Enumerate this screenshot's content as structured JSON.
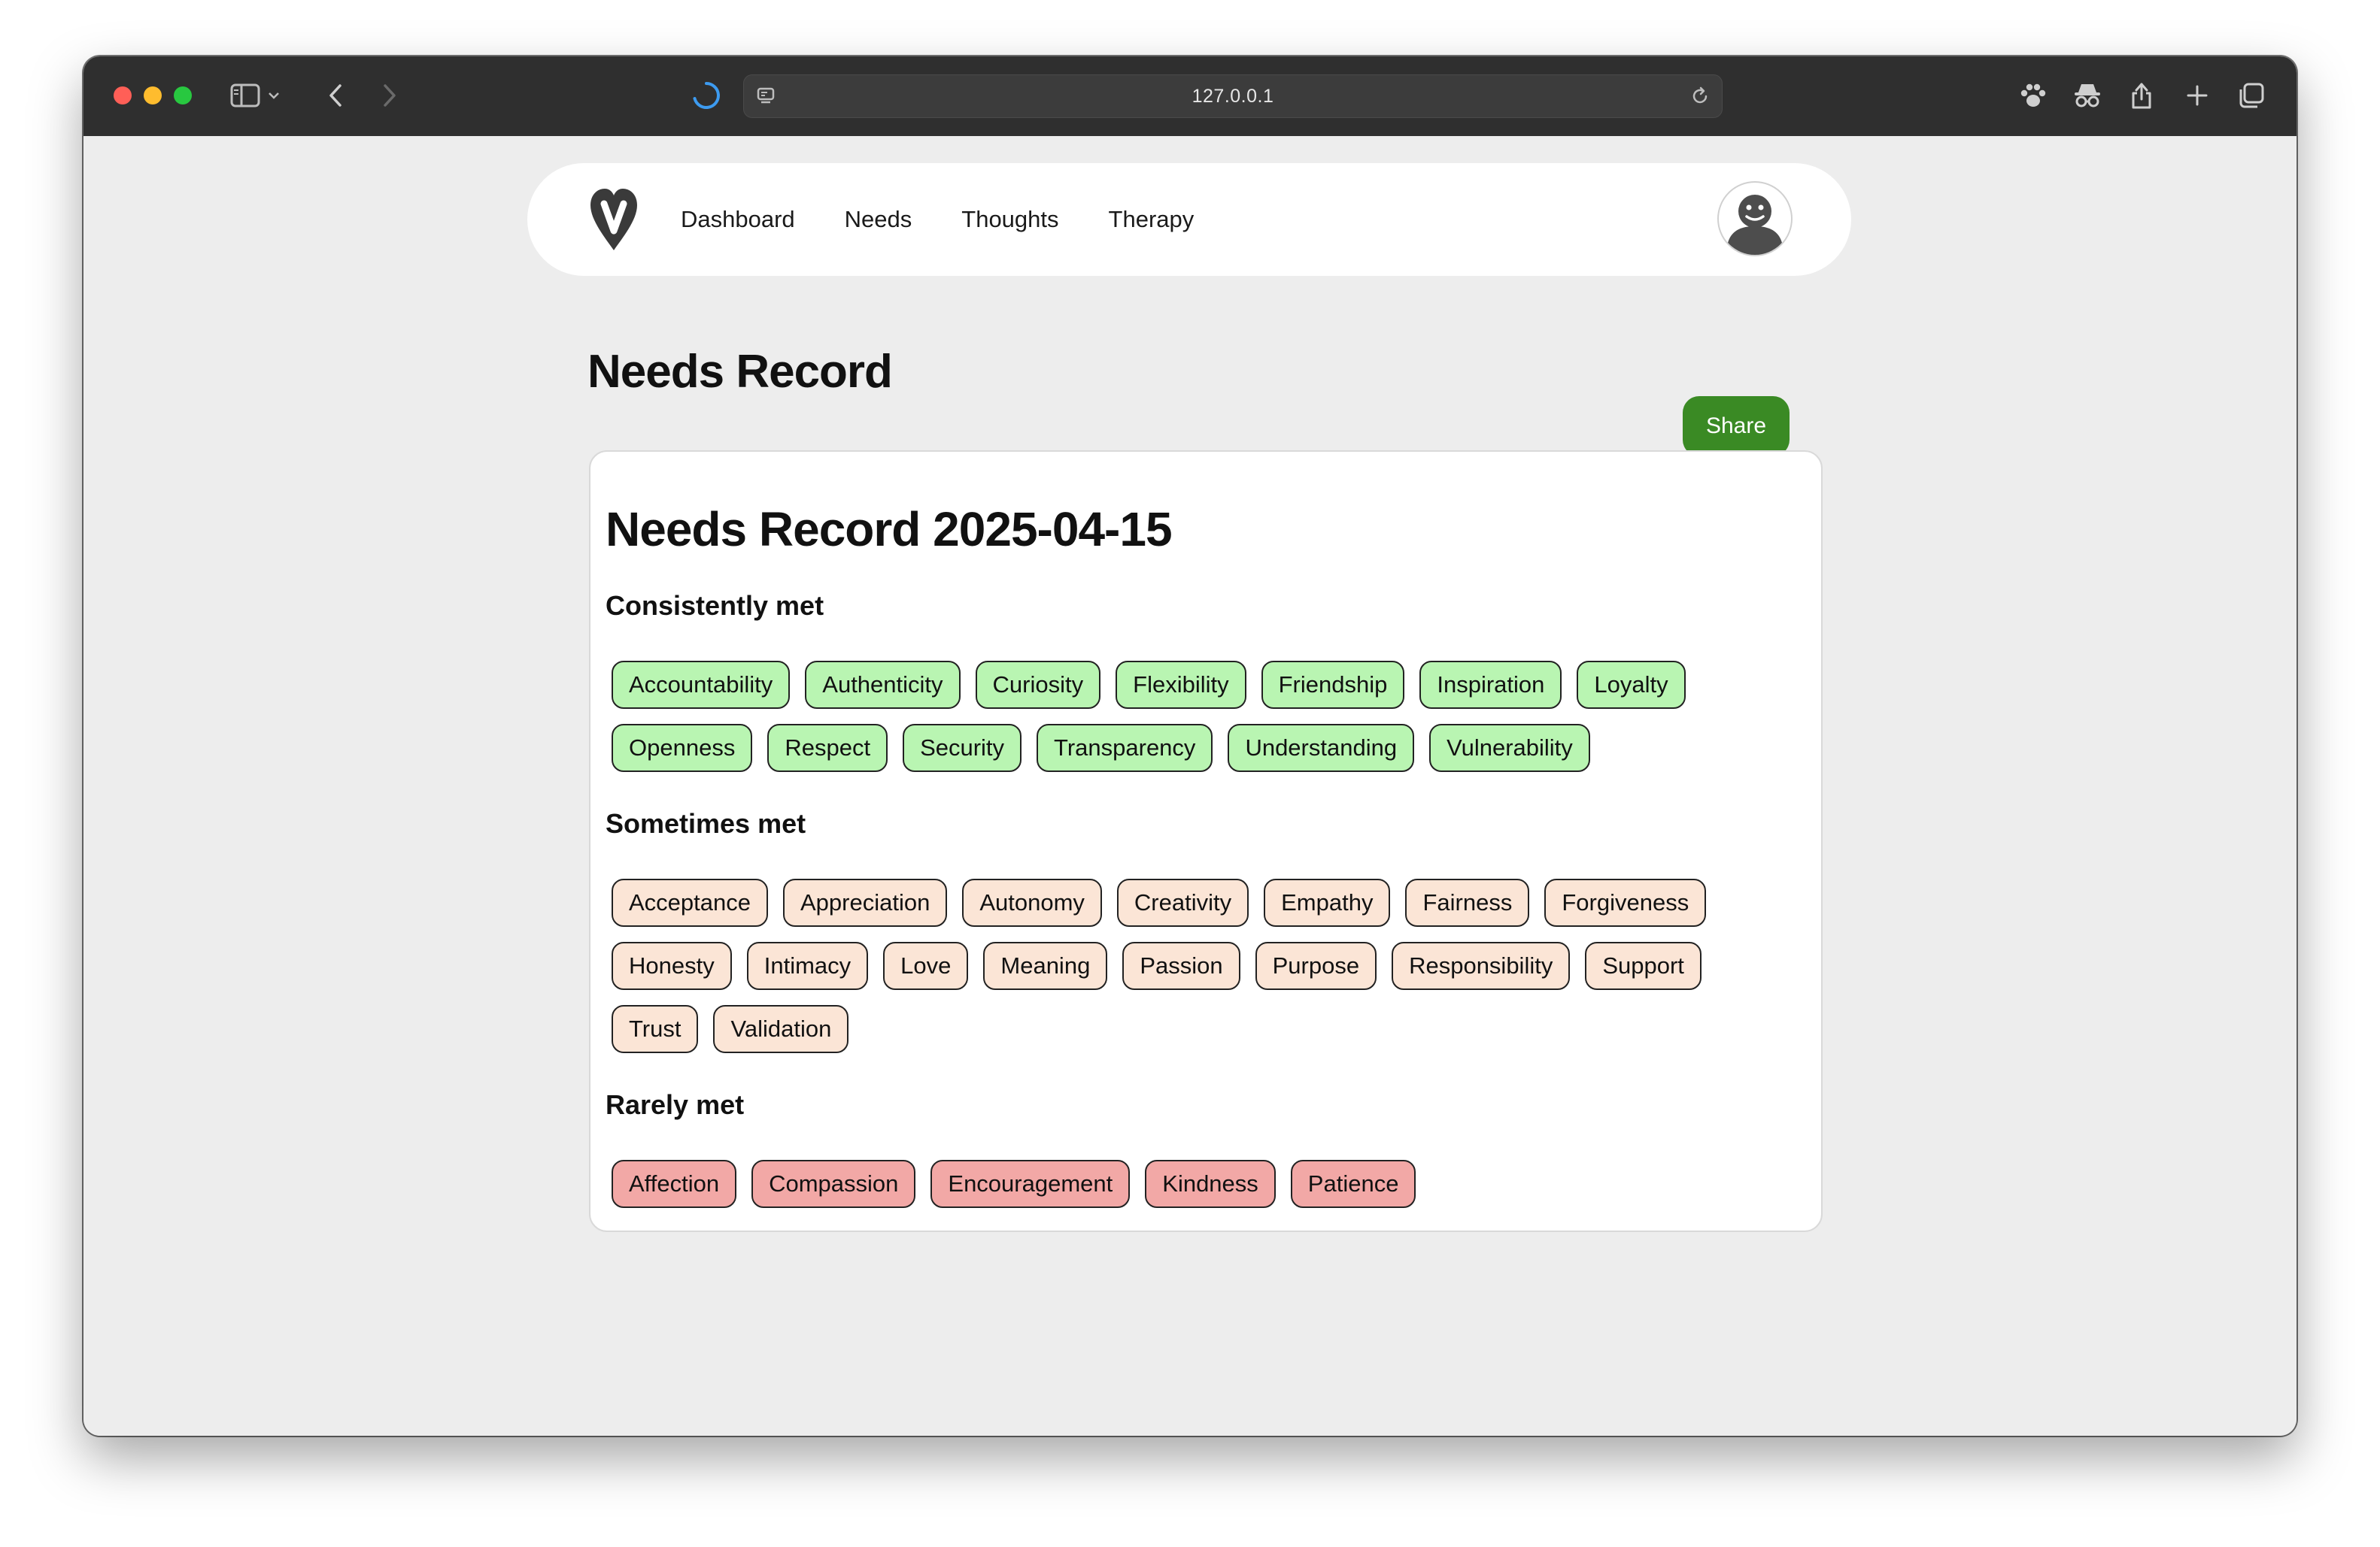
{
  "browser": {
    "url": "127.0.0.1",
    "icons": [
      "sidebar-icon",
      "chevron-down-icon",
      "back-icon",
      "forward-icon",
      "loading-spinner-icon",
      "site-settings-icon",
      "reload-icon",
      "paw-icon",
      "incognito-icon",
      "share-icon",
      "new-tab-icon",
      "tabs-overview-icon"
    ]
  },
  "nav": {
    "links": [
      "Dashboard",
      "Needs",
      "Thoughts",
      "Therapy"
    ]
  },
  "page": {
    "title": "Needs Record",
    "share_label": "Share"
  },
  "record": {
    "title": "Needs Record 2025-04-15",
    "sections": [
      {
        "heading": "Consistently met",
        "color": "#b9f5b2",
        "needs": [
          "Accountability",
          "Authenticity",
          "Curiosity",
          "Flexibility",
          "Friendship",
          "Inspiration",
          "Loyalty",
          "Openness",
          "Respect",
          "Security",
          "Transparency",
          "Understanding",
          "Vulnerability"
        ]
      },
      {
        "heading": "Sometimes met",
        "color": "#fbe5d6",
        "needs": [
          "Acceptance",
          "Appreciation",
          "Autonomy",
          "Creativity",
          "Empathy",
          "Fairness",
          "Forgiveness",
          "Honesty",
          "Intimacy",
          "Love",
          "Meaning",
          "Passion",
          "Purpose",
          "Responsibility",
          "Support",
          "Trust",
          "Validation"
        ]
      },
      {
        "heading": "Rarely met",
        "color": "#f2a8a6",
        "needs": [
          "Affection",
          "Compassion",
          "Encouragement",
          "Kindness",
          "Patience"
        ]
      }
    ]
  },
  "colors": {
    "share_button": "#3a8a24",
    "page_background": "#ededed"
  }
}
